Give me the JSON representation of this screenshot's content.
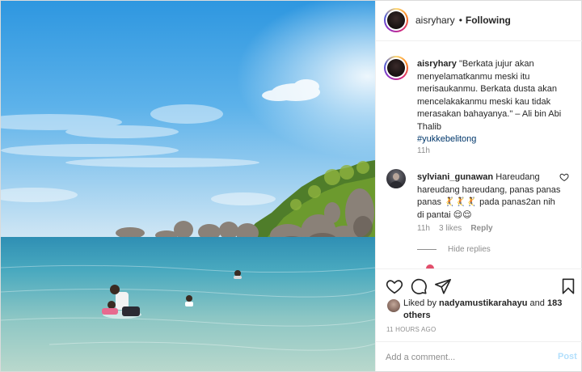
{
  "header": {
    "username": "aisryhary",
    "separator": "•",
    "follow_status": "Following"
  },
  "caption": {
    "username": "aisryhary",
    "text": "\"Berkata jujur akan menyelamatkanmu meski itu merisaukanmu. Berkata dusta akan mencelakakanmu meski kau tidak merasakan bahayanya.\" – Ali bin Abi Thalib",
    "hashtag": "#yukkebelitong",
    "time": "11h"
  },
  "comment": {
    "username": "sylviani_gunawan",
    "text": "Hareudang hareudang hareudang, panas panas panas 🤾🤾🤾 pada panas2an nih di pantai 😌😌",
    "time": "11h",
    "likes": "3 likes",
    "reply_label": "Reply",
    "hide_replies_label": "Hide replies"
  },
  "likes": {
    "prefix": "Liked by",
    "user": "nadyamustikarahayu",
    "conjunction": "and",
    "others": "183 others"
  },
  "timestamp": "11 HOURS AGO",
  "add_comment": {
    "placeholder": "Add a comment...",
    "post_label": "Post"
  },
  "colors": {
    "link": "#00376b",
    "muted": "#8e8e8e",
    "post_disabled": "#b2dffc",
    "border": "#efefef"
  },
  "icons": {
    "like": "heart-icon",
    "comment": "comment-bubble-icon",
    "share": "paper-plane-icon",
    "save": "bookmark-icon",
    "comment_like": "small-heart-icon"
  }
}
